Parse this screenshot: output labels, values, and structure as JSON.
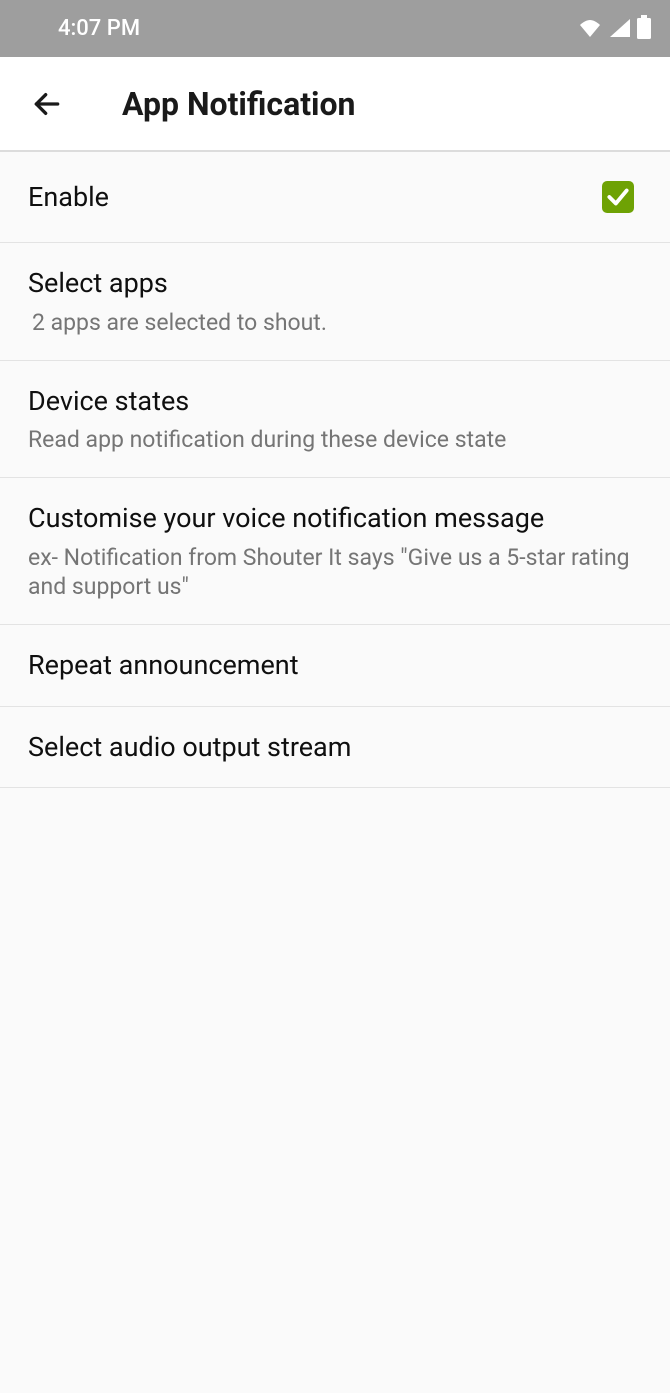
{
  "status_bar": {
    "time": "4:07 PM"
  },
  "app_bar": {
    "title": "App Notification"
  },
  "items": [
    {
      "title": "Enable"
    },
    {
      "title": "Select apps",
      "subtitle": "2 apps are selected to shout."
    },
    {
      "title": "Device states",
      "subtitle": "Read app notification during these device state"
    },
    {
      "title": "Customise your voice notification message",
      "subtitle": "ex- Notification from Shouter It says \"Give us a 5-star rating and support us\""
    },
    {
      "title": "Repeat announcement"
    },
    {
      "title": "Select audio output stream"
    }
  ]
}
